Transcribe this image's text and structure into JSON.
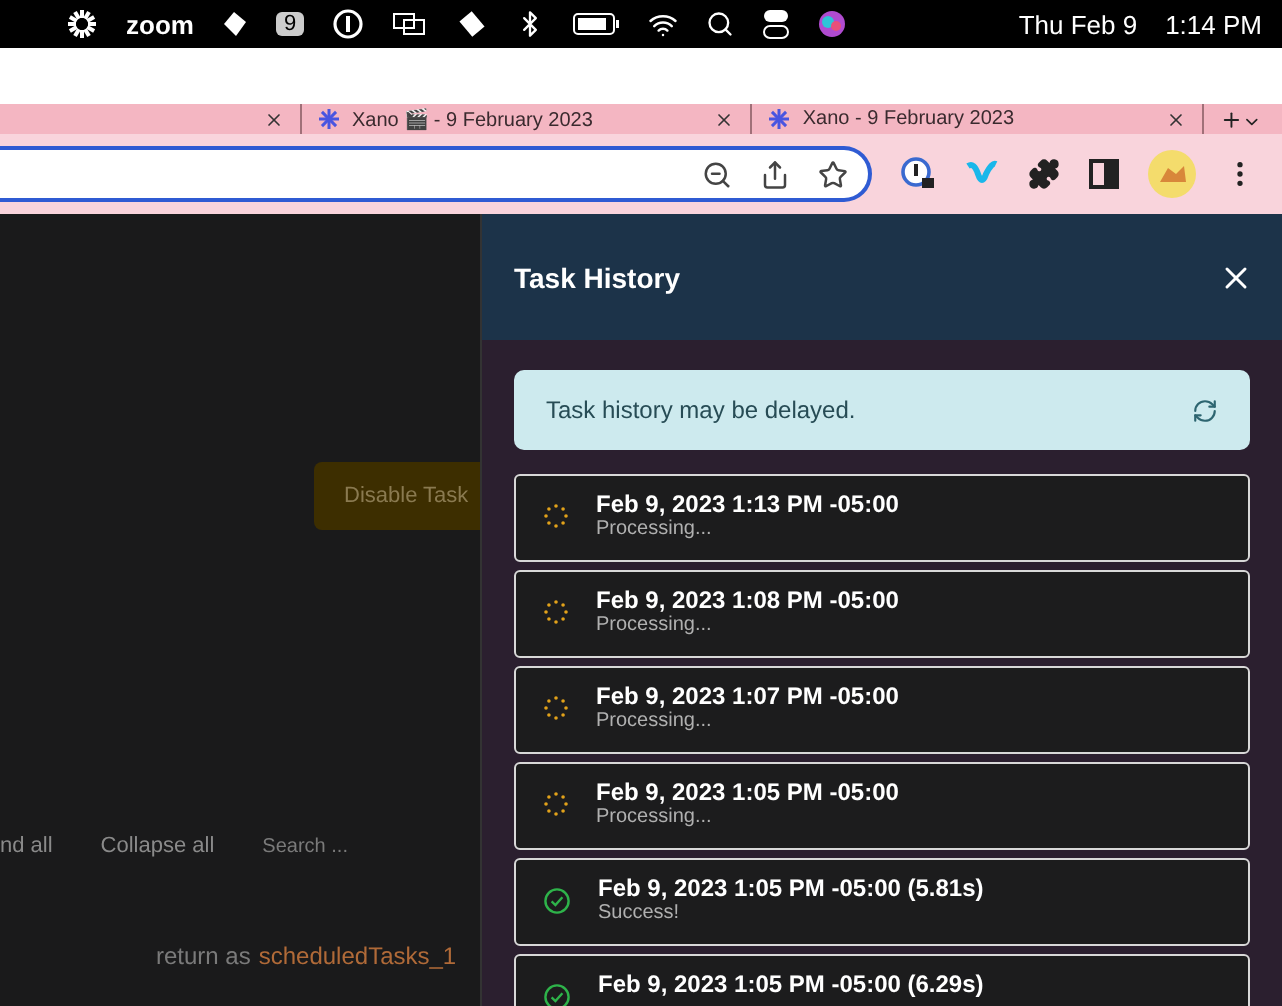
{
  "menubar": {
    "app": "zoom",
    "badge": "9",
    "date": "Thu Feb 9",
    "time": "1:14 PM"
  },
  "tabs": [
    {
      "selected": false
    },
    {
      "title": "Xano 🎬 - 9 February 2023",
      "selected": false
    },
    {
      "title": "Xano - 9 February 2023",
      "selected": false
    }
  ],
  "page": {
    "disable_button": "Disable Task",
    "expand_all": "nd all",
    "collapse_all": "Collapse all",
    "search": {
      "placeholder": "Search ..."
    },
    "code_prefix": "return as",
    "code_var": "scheduledTasks_1"
  },
  "panel": {
    "title": "Task History",
    "notice": "Task history may be delayed.",
    "entries": [
      {
        "kind": "processing",
        "time": "Feb 9, 2023 1:13 PM -05:00",
        "status": "Processing..."
      },
      {
        "kind": "processing",
        "time": "Feb 9, 2023 1:08 PM -05:00",
        "status": "Processing..."
      },
      {
        "kind": "processing",
        "time": "Feb 9, 2023 1:07 PM -05:00",
        "status": "Processing..."
      },
      {
        "kind": "processing",
        "time": "Feb 9, 2023 1:05 PM -05:00",
        "status": "Processing..."
      },
      {
        "kind": "success",
        "time": "Feb 9, 2023 1:05 PM -05:00 (5.81s)",
        "status": "Success!"
      },
      {
        "kind": "success",
        "time": "Feb 9, 2023 1:05 PM -05:00 (6.29s)"
      }
    ]
  }
}
